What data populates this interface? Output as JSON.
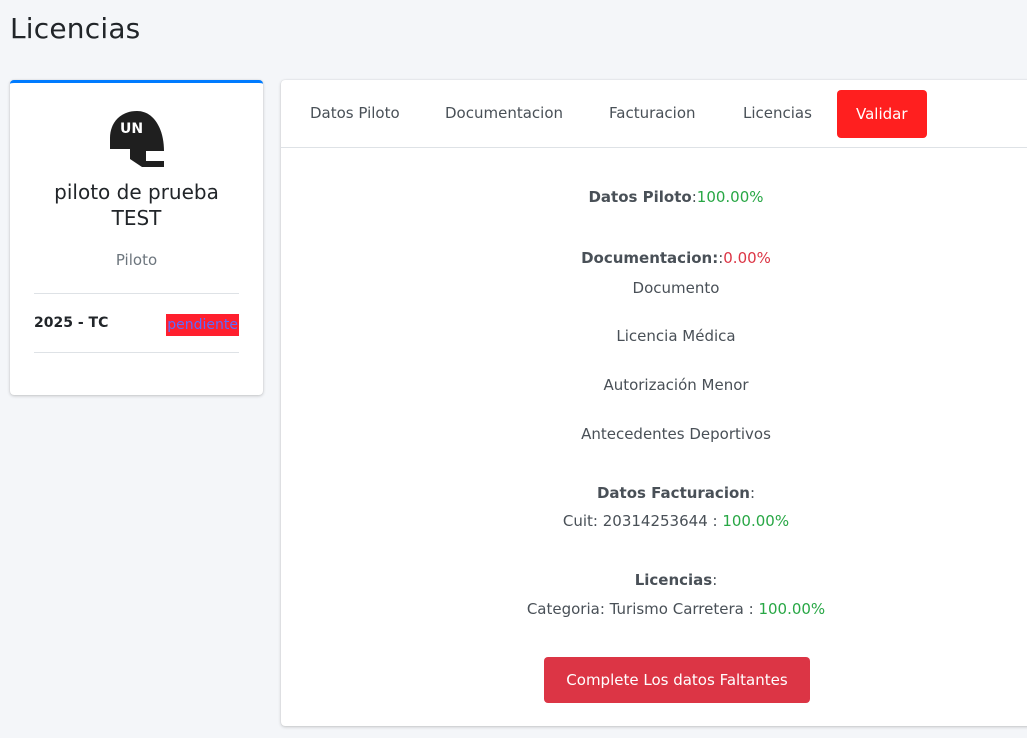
{
  "page": {
    "title": "Licencias"
  },
  "profile": {
    "name": "piloto de prueba TEST",
    "role": "Piloto",
    "licenses": [
      {
        "label": "2025 - TC",
        "status": "pendiente"
      }
    ]
  },
  "tabs": [
    {
      "label": "Datos Piloto"
    },
    {
      "label": "Documentacion"
    },
    {
      "label": "Facturacion"
    },
    {
      "label": "Licencias"
    },
    {
      "label": "Validar",
      "active": true
    }
  ],
  "summary": {
    "datos_piloto": {
      "label": "Datos Piloto",
      "sep": ":",
      "value": "100.00%"
    },
    "documentacion": {
      "label": "Documentacion:",
      "sep": ":",
      "value": "0.00%",
      "items": [
        "Documento",
        "Licencia Médica",
        "Autorización Menor",
        "Antecedentes Deportivos"
      ]
    },
    "facturacion": {
      "label": "Datos Facturacion",
      "sep": ":",
      "detail": "Cuit: 20314253644 : ",
      "value": "100.00%"
    },
    "licencias": {
      "label": "Licencias",
      "sep": ":",
      "detail": "Categoria: Turismo Carretera : ",
      "value": "100.00%"
    }
  },
  "cta": {
    "label": "Complete Los datos Faltantes"
  },
  "colors": {
    "accent": "#007bff",
    "success": "#28a745",
    "danger": "#dc3545",
    "active_tab": "#ff1f1f"
  }
}
